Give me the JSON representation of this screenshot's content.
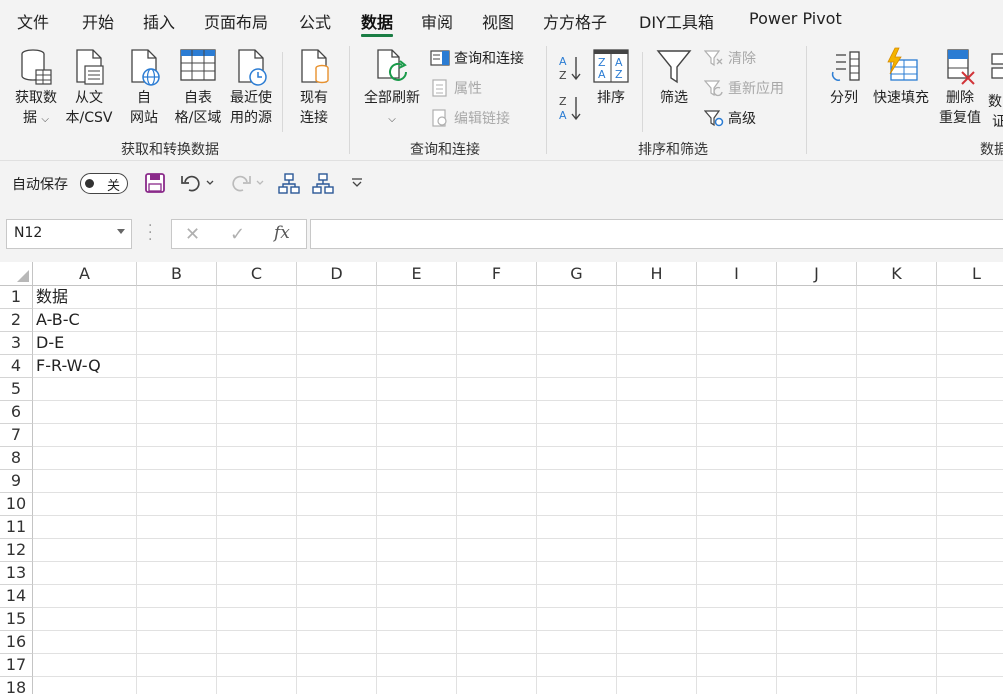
{
  "menu": {
    "tabs": [
      {
        "label": "文件",
        "active": false
      },
      {
        "label": "开始",
        "active": false
      },
      {
        "label": "插入",
        "active": false
      },
      {
        "label": "页面布局",
        "active": false
      },
      {
        "label": "公式",
        "active": false
      },
      {
        "label": "数据",
        "active": true
      },
      {
        "label": "审阅",
        "active": false
      },
      {
        "label": "视图",
        "active": false
      },
      {
        "label": "方方格子",
        "active": false
      },
      {
        "label": "DIY工具箱",
        "active": false
      },
      {
        "label": "Power Pivot",
        "active": false
      }
    ]
  },
  "ribbon": {
    "get_data": {
      "l1": "获取数",
      "l2": "据"
    },
    "from_csv": {
      "l1": "从文",
      "l2": "本/CSV"
    },
    "from_web": {
      "l1": "自",
      "l2": "网站"
    },
    "from_table": {
      "l1": "自表",
      "l2": "格/区域"
    },
    "recent": {
      "l1": "最近使",
      "l2": "用的源"
    },
    "existing": {
      "l1": "现有",
      "l2": "连接"
    },
    "group_get": "获取和转换数据",
    "refresh_all": "全部刷新",
    "queries_connections": "查询和连接",
    "properties": "属性",
    "edit_links": "编辑链接",
    "group_query": "查询和连接",
    "sort": "排序",
    "filter": "筛选",
    "clear": "清除",
    "reapply": "重新应用",
    "advanced": "高级",
    "group_sort": "排序和筛选",
    "split": "分列",
    "flash_fill": "快速填充",
    "remove_dup": {
      "l1": "删除",
      "l2": "重复值"
    },
    "data_validation_partial": {
      "l1": "数",
      "l2": "证"
    },
    "group_tools_partial": "数据"
  },
  "qat": {
    "autosave_label": "自动保存",
    "autosave_state": "关"
  },
  "formula_bar": {
    "namebox": "N12",
    "formula": ""
  },
  "grid": {
    "columns": [
      "A",
      "B",
      "C",
      "D",
      "E",
      "F",
      "G",
      "H",
      "I",
      "J",
      "K",
      "L"
    ],
    "rows": [
      "1",
      "2",
      "3",
      "4",
      "5",
      "6",
      "7",
      "8",
      "9",
      "10",
      "11",
      "12",
      "13",
      "14",
      "15",
      "16",
      "17",
      "18"
    ],
    "cells": {
      "A1": "数据",
      "A2": "A-B-C",
      "A3": "D-E",
      "A4": "F-R-W-Q"
    }
  },
  "colors": {
    "accent_green": "#1a7d44",
    "icon_blue": "#2b7cd3",
    "icon_orange": "#e8912d",
    "icon_red": "#d13438",
    "save_purple": "#8a2a8a"
  }
}
